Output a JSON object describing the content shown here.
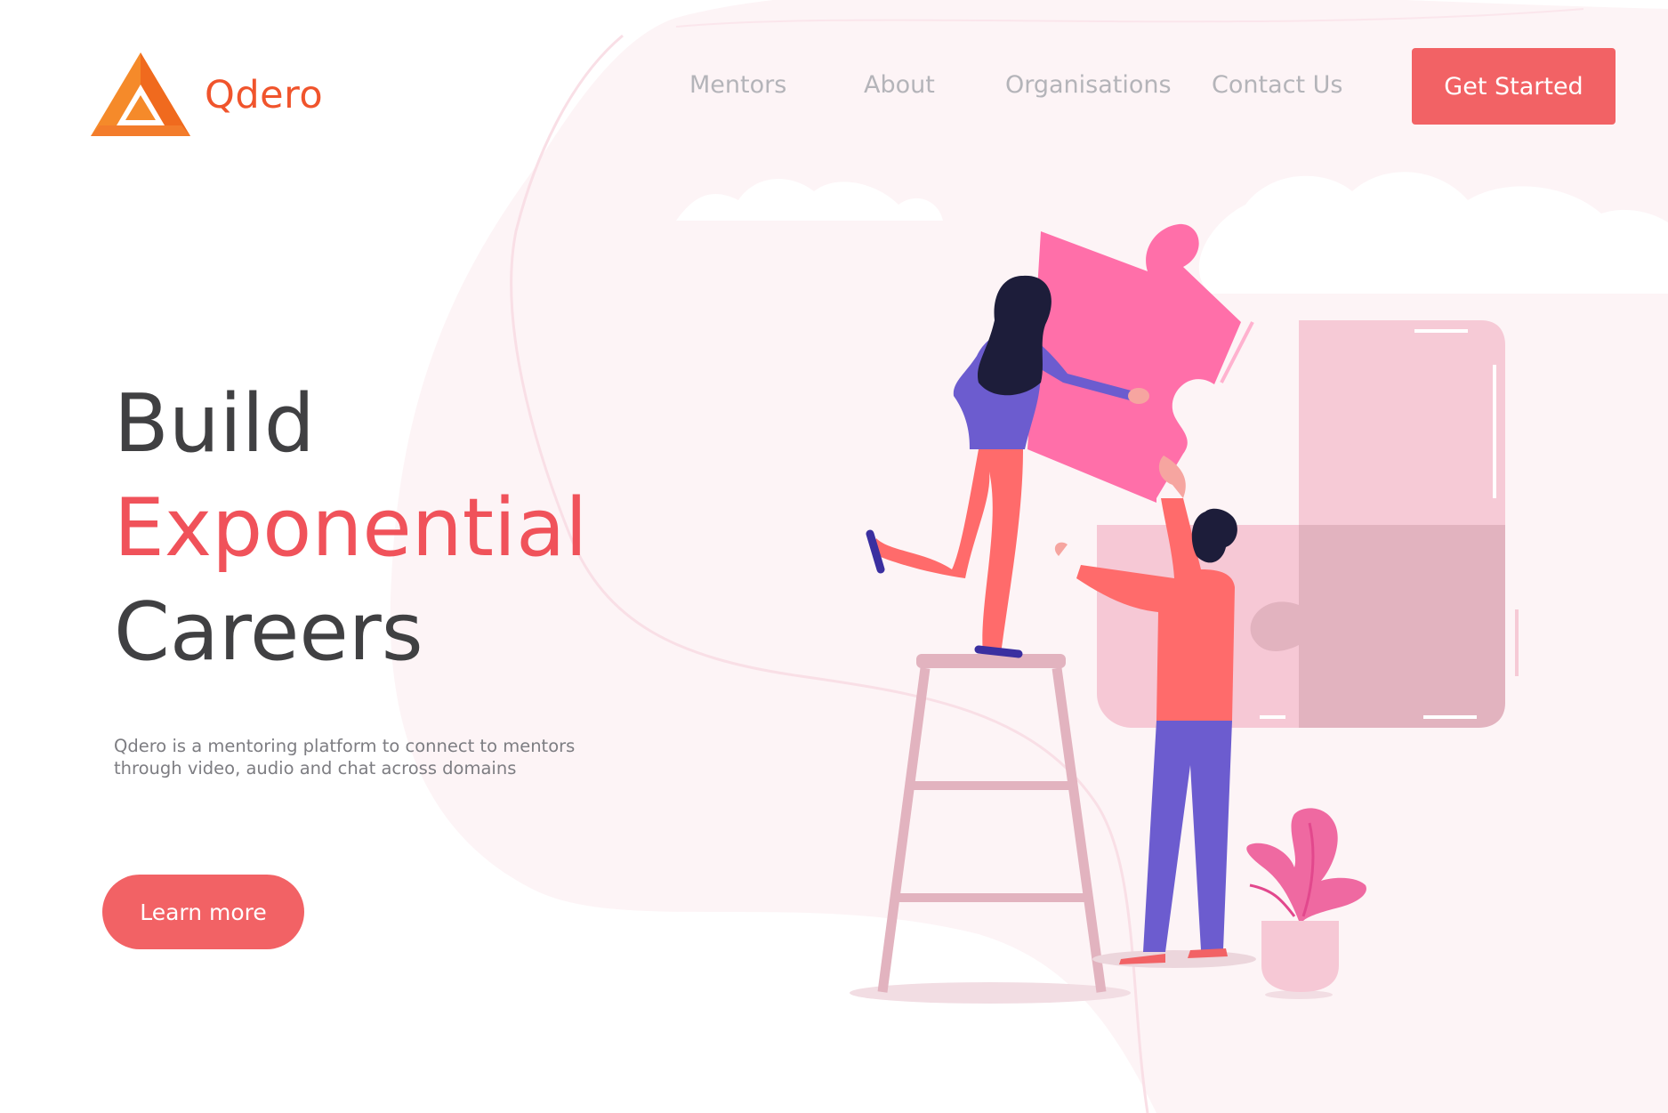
{
  "brand": {
    "name": "Qdero"
  },
  "nav": {
    "items": [
      {
        "label": "Mentors"
      },
      {
        "label": "About"
      },
      {
        "label": "Organisations"
      },
      {
        "label": "Contact Us"
      }
    ],
    "cta_label": "Get Started"
  },
  "hero": {
    "line1": "Build",
    "line2": "Exponential",
    "line3": "Careers",
    "description": "Qdero is a mentoring platform to connect to mentors through video, audio and chat across domains",
    "button_label": "Learn more"
  },
  "colors": {
    "accent": "#f26265",
    "headline_accent": "#f0525a",
    "brand_orange": "#f0542c",
    "nav_text": "#b4b4b9",
    "dark_text": "#404042"
  },
  "icons": {
    "logo": "triangle-logo-icon"
  }
}
